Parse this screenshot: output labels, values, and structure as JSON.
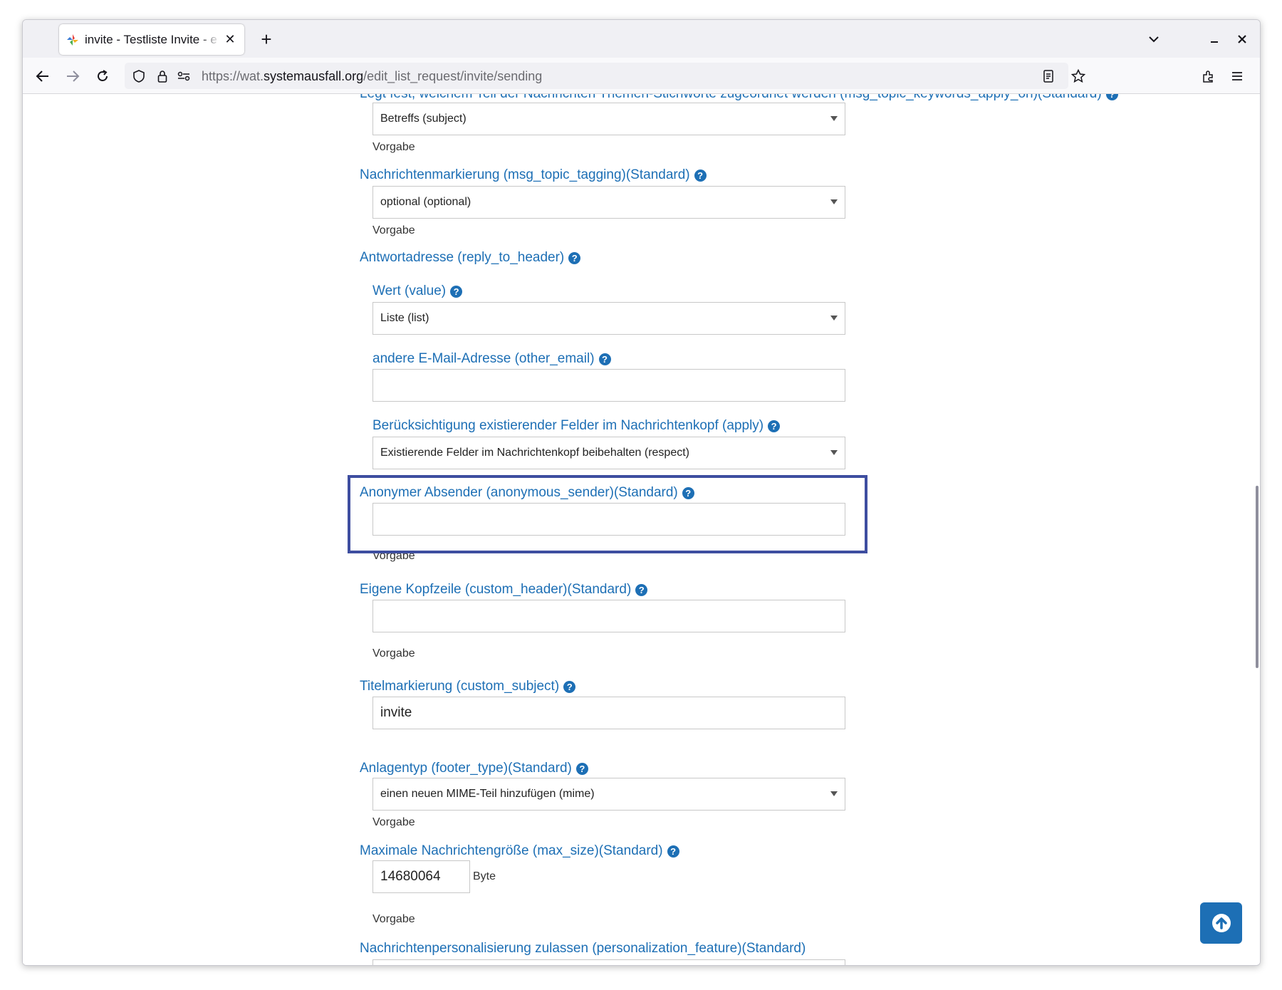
{
  "browser": {
    "tab_title": "invite - Testliste Invite - e",
    "url_prefix": "https://wat.",
    "url_domain": "systemausfall.org",
    "url_path": "/edit_list_request/invite/sending"
  },
  "form": {
    "topic_apply": {
      "label": "Legt fest, welchem Teil der Nachrichten Themen-Stichworte zugeordnet werden (msg_topic_keywords_apply_on)(Standard)",
      "value": "Betreffs (subject)",
      "hint": "Vorgabe"
    },
    "topic_tagging": {
      "label": "Nachrichtenmarkierung (msg_topic_tagging)(Standard)",
      "value": "optional (optional)",
      "hint": "Vorgabe"
    },
    "reply_to": {
      "label": "Antwortadresse (reply_to_header)",
      "value_label": "Wert (value)",
      "value": "Liste (list)",
      "other_email_label": "andere E-Mail-Adresse (other_email)",
      "other_email": "",
      "apply_label": "Berücksichtigung existierender Felder im Nachrichtenkopf (apply)",
      "apply": "Existierende Felder im Nachrichtenkopf beibehalten (respect)"
    },
    "anonymous_sender": {
      "label": "Anonymer Absender (anonymous_sender)(Standard)",
      "value": "",
      "hint": "Vorgabe"
    },
    "custom_header": {
      "label": "Eigene Kopfzeile (custom_header)(Standard)",
      "value": "",
      "hint": "Vorgabe"
    },
    "custom_subject": {
      "label": "Titelmarkierung (custom_subject)",
      "value": "invite"
    },
    "footer_type": {
      "label": "Anlagentyp (footer_type)(Standard)",
      "value": "einen neuen MIME-Teil hinzufügen (mime)",
      "hint": "Vorgabe"
    },
    "max_size": {
      "label": "Maximale Nachrichtengröße (max_size)(Standard)",
      "value": "14680064",
      "unit": "Byte",
      "hint": "Vorgabe"
    },
    "personalization": {
      "label": "Nachrichtenpersonalisierung zulassen (personalization_feature)(Standard)"
    },
    "help_glyph": "?"
  },
  "colors": {
    "label_blue": "#1d6fb5",
    "highlight": "#3e4ea0"
  }
}
